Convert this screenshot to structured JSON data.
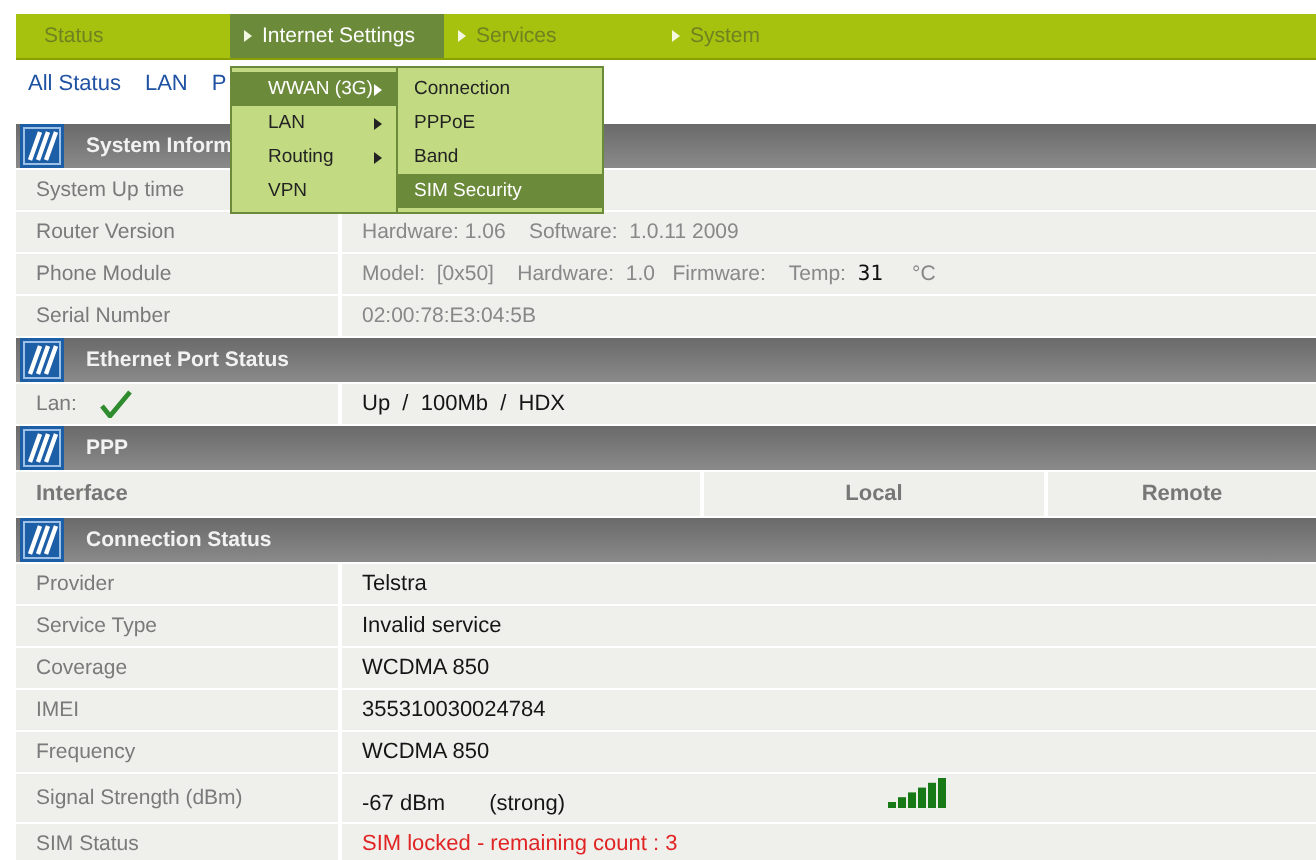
{
  "nav": {
    "tabs": [
      {
        "label": "Status",
        "arrow": false,
        "selected": false
      },
      {
        "label": "Internet Settings",
        "arrow": true,
        "selected": true
      },
      {
        "label": "Services",
        "arrow": true,
        "selected": false
      },
      {
        "label": "System",
        "arrow": true,
        "selected": false
      }
    ]
  },
  "subnav": {
    "links": [
      "All Status",
      "LAN",
      "P"
    ]
  },
  "menu": {
    "items": [
      {
        "label": "WWAN (3G)",
        "submenu": true,
        "selected": true
      },
      {
        "label": "LAN",
        "submenu": true,
        "selected": false
      },
      {
        "label": "Routing",
        "submenu": true,
        "selected": false
      },
      {
        "label": "VPN",
        "submenu": false,
        "selected": false
      }
    ],
    "submenu": {
      "items": [
        {
          "label": "Connection",
          "selected": false
        },
        {
          "label": "PPPoE",
          "selected": false
        },
        {
          "label": "Band",
          "selected": false
        },
        {
          "label": "SIM Security",
          "selected": true
        }
      ]
    }
  },
  "sections": [
    {
      "title": "System Inform",
      "kind": "details",
      "rows": [
        {
          "label": "System Up time",
          "warning": false
        },
        {
          "label": "Router Version",
          "value": "Hardware: 1.06    Software:  1.0.11 2009",
          "warning": false
        },
        {
          "label": "Phone Module",
          "value": "Model:  [0x50]    Hardware:  1.0   Firmware:    Temp:  **31**     °C",
          "warning": false
        },
        {
          "label": "Serial Number",
          "value": "02:00:78:E3:04:5B",
          "warning": false
        }
      ]
    },
    {
      "title": "Ethernet Port Status",
      "kind": "status",
      "rows": [
        {
          "label": "Lan:",
          "check": true,
          "value": "Up  /  100Mb  /  HDX",
          "warning": false
        }
      ]
    },
    {
      "title": "PPP",
      "kind": "table",
      "columns": [
        "Interface",
        "Local",
        "Remote"
      ]
    },
    {
      "title": "Connection Status",
      "kind": "status",
      "rows": [
        {
          "label": "Provider",
          "value": "Telstra",
          "warning": false
        },
        {
          "label": "Service Type",
          "value": "Invalid service",
          "warning": false
        },
        {
          "label": "Coverage",
          "value": "WCDMA 850",
          "warning": false
        },
        {
          "label": "IMEI",
          "value": "355310030024784",
          "warning": false
        },
        {
          "label": "Frequency",
          "value": "WCDMA 850",
          "warning": false
        },
        {
          "label": "Signal Strength (dBm)",
          "value": "-67 dBm",
          "extra": "(strong)",
          "signal": true,
          "warning": false
        },
        {
          "label": "SIM Status",
          "value": "SIM locked - remaining count : 3",
          "warning": true
        }
      ]
    }
  ]
}
